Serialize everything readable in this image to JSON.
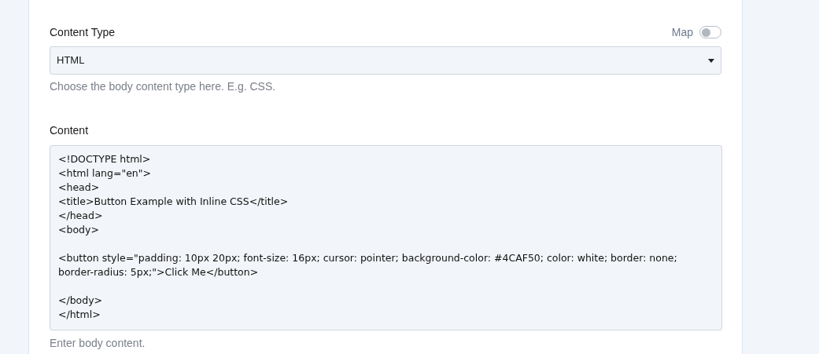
{
  "content_type": {
    "label": "Content Type",
    "map_toggle": {
      "label": "Map",
      "on": false
    },
    "value": "HTML",
    "help": "Choose the body content type here. E.g. CSS."
  },
  "content": {
    "label": "Content",
    "value": "<!DOCTYPE html>\n<html lang=\"en\">\n<head>\n<title>Button Example with Inline CSS</title>\n</head>\n<body>\n\n<button style=\"padding: 10px 20px; font-size: 16px; cursor: pointer; background-color: #4CAF50; color: white; border: none; border-radius: 5px;\">Click Me</button>\n\n</body>\n</html>",
    "help": "Enter body content."
  }
}
